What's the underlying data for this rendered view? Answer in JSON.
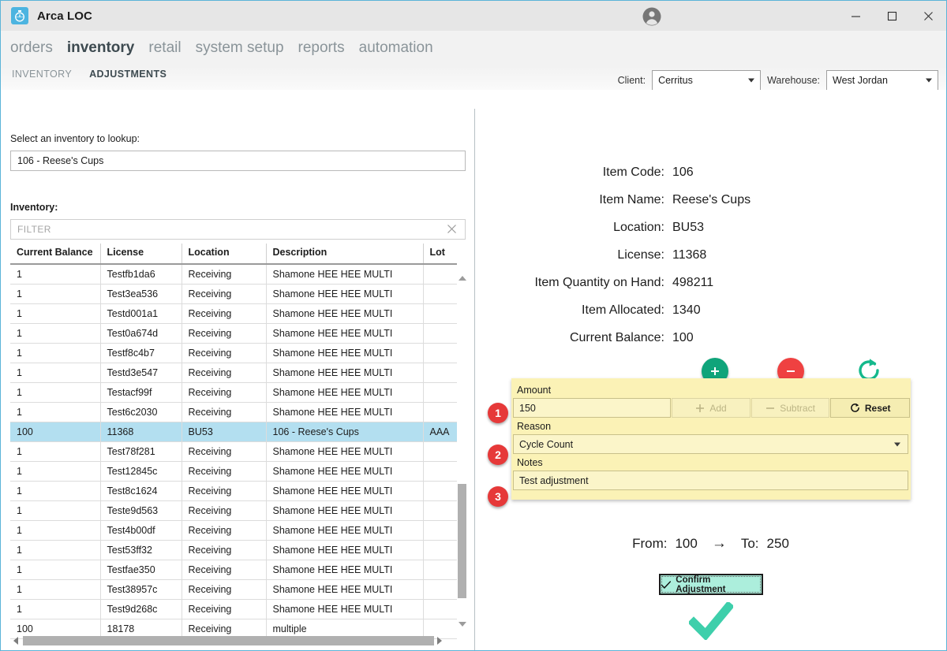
{
  "window": {
    "app_icon": "stopwatch-icon",
    "title": "Arca LOC",
    "minimize": "–",
    "maximize": "□",
    "close": "✕",
    "account_icon": "account-circle-icon"
  },
  "nav": {
    "main_items": [
      {
        "label": "orders",
        "active": false
      },
      {
        "label": "inventory",
        "active": true
      },
      {
        "label": "retail",
        "active": false
      },
      {
        "label": "system setup",
        "active": false
      },
      {
        "label": "reports",
        "active": false
      },
      {
        "label": "automation",
        "active": false
      }
    ],
    "sub_items": [
      {
        "label": "INVENTORY",
        "active": false
      },
      {
        "label": "ADJUSTMENTS",
        "active": true
      }
    ],
    "client_label": "Client:",
    "client_value": "Cerritus",
    "warehouse_label": "Warehouse:",
    "warehouse_value": "West Jordan"
  },
  "left": {
    "lookup_label": "Select an inventory to lookup:",
    "lookup_value": "106 - Reese's Cups",
    "inventory_label": "Inventory:",
    "filter_placeholder": "FILTER",
    "filter_value": "",
    "filter_clear_icon": "close-icon",
    "columns": [
      "Current Balance",
      "License",
      "Location",
      "Description",
      "Lot"
    ],
    "rows": [
      {
        "balance": "1",
        "license": "Testfb1da6",
        "location": "Receiving",
        "description": "Shamone HEE HEE MULTI",
        "lot": "",
        "selected": false
      },
      {
        "balance": "1",
        "license": "Test3ea536",
        "location": "Receiving",
        "description": "Shamone HEE HEE MULTI",
        "lot": "",
        "selected": false
      },
      {
        "balance": "1",
        "license": "Testd001a1",
        "location": "Receiving",
        "description": "Shamone HEE HEE MULTI",
        "lot": "",
        "selected": false
      },
      {
        "balance": "1",
        "license": "Test0a674d",
        "location": "Receiving",
        "description": "Shamone HEE HEE MULTI",
        "lot": "",
        "selected": false
      },
      {
        "balance": "1",
        "license": "Testf8c4b7",
        "location": "Receiving",
        "description": "Shamone HEE HEE MULTI",
        "lot": "",
        "selected": false
      },
      {
        "balance": "1",
        "license": "Testd3e547",
        "location": "Receiving",
        "description": "Shamone HEE HEE MULTI",
        "lot": "",
        "selected": false
      },
      {
        "balance": "1",
        "license": "Testacf99f",
        "location": "Receiving",
        "description": "Shamone HEE HEE MULTI",
        "lot": "",
        "selected": false
      },
      {
        "balance": "1",
        "license": "Test6c2030",
        "location": "Receiving",
        "description": "Shamone HEE HEE MULTI",
        "lot": "",
        "selected": false
      },
      {
        "balance": "100",
        "license": "11368",
        "location": "BU53",
        "description": "106 - Reese's Cups",
        "lot": "AAA",
        "selected": true
      },
      {
        "balance": "1",
        "license": "Test78f281",
        "location": "Receiving",
        "description": "Shamone HEE HEE MULTI",
        "lot": "",
        "selected": false
      },
      {
        "balance": "1",
        "license": "Test12845c",
        "location": "Receiving",
        "description": "Shamone HEE HEE MULTI",
        "lot": "",
        "selected": false
      },
      {
        "balance": "1",
        "license": "Test8c1624",
        "location": "Receiving",
        "description": "Shamone HEE HEE MULTI",
        "lot": "",
        "selected": false
      },
      {
        "balance": "1",
        "license": "Teste9d563",
        "location": "Receiving",
        "description": "Shamone HEE HEE MULTI",
        "lot": "",
        "selected": false
      },
      {
        "balance": "1",
        "license": "Test4b00df",
        "location": "Receiving",
        "description": "Shamone HEE HEE MULTI",
        "lot": "",
        "selected": false
      },
      {
        "balance": "1",
        "license": "Test53ff32",
        "location": "Receiving",
        "description": "Shamone HEE HEE MULTI",
        "lot": "",
        "selected": false
      },
      {
        "balance": "1",
        "license": "Testfae350",
        "location": "Receiving",
        "description": "Shamone HEE HEE MULTI",
        "lot": "",
        "selected": false
      },
      {
        "balance": "1",
        "license": "Test38957c",
        "location": "Receiving",
        "description": "Shamone HEE HEE MULTI",
        "lot": "",
        "selected": false
      },
      {
        "balance": "1",
        "license": "Test9d268c",
        "location": "Receiving",
        "description": "Shamone HEE HEE MULTI",
        "lot": "",
        "selected": false
      },
      {
        "balance": "100",
        "license": "18178",
        "location": "Receiving",
        "description": "multiple",
        "lot": "",
        "selected": false
      }
    ]
  },
  "detail": {
    "fields": [
      {
        "label": "Item Code:",
        "value": "106"
      },
      {
        "label": "Item Name:",
        "value": "Reese's Cups"
      },
      {
        "label": "Location:",
        "value": "BU53"
      },
      {
        "label": "License:",
        "value": "11368"
      },
      {
        "label": "Item Quantity on Hand:",
        "value": "498211"
      },
      {
        "label": "Item Allocated:",
        "value": "1340"
      },
      {
        "label": "Current Balance:",
        "value": "100"
      }
    ]
  },
  "actions": {
    "plus_icon": "plus-circle-icon",
    "minus_icon": "minus-circle-icon",
    "refresh_icon": "refresh-icon"
  },
  "form": {
    "badge1": "1",
    "badge2": "2",
    "badge3": "3",
    "amount_label": "Amount",
    "amount_value": "150",
    "add_label": "Add",
    "add_icon": "plus-icon",
    "subtract_label": "Subtract",
    "subtract_icon": "minus-icon",
    "reset_label": "Reset",
    "reset_icon": "refresh-icon",
    "reason_label": "Reason",
    "reason_value": "Cycle Count",
    "notes_label": "Notes",
    "notes_value": "Test adjustment"
  },
  "summary": {
    "from_label": "From:",
    "from_value": "100",
    "arrow": "→",
    "to_label": "To:",
    "to_value": "250",
    "confirm_label": "Confirm Adjustment",
    "confirm_icon": "check-icon",
    "big_check_icon": "check-icon"
  },
  "colors": {
    "window_border": "#5bb4d8",
    "titlebar": "#e6e6e6",
    "app_icon": "#4cb4e0",
    "nav_active": "#3d4a50",
    "nav_inactive": "#8a9499",
    "row_selected": "#b3dff0",
    "form_panel": "#fbf2b6",
    "badge": "#e63939",
    "plus": "#0fa47a",
    "minus": "#ef4141",
    "confirm": "#aceedc",
    "check": "#3ecfab"
  }
}
